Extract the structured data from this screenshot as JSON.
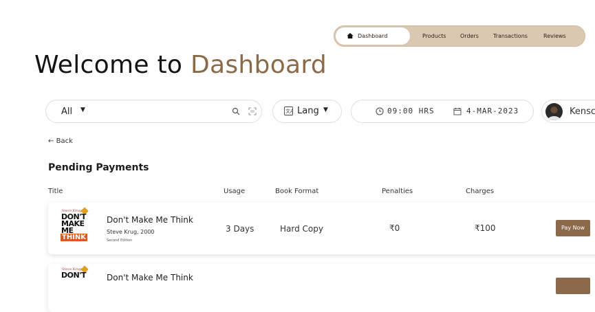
{
  "nav": {
    "items": [
      {
        "label": "Dashboard",
        "active": true
      },
      {
        "label": "Products"
      },
      {
        "label": "Orders"
      },
      {
        "label": "Transactions"
      },
      {
        "label": "Reviews"
      }
    ],
    "colors": {
      "pill": "#dcc8b2",
      "accent": "#8a6a48"
    }
  },
  "header": {
    "title_prefix": "Welcome to ",
    "title_accent": "Dashboard"
  },
  "search": {
    "filter": "All",
    "icons": [
      "search-icon",
      "scan-icon"
    ]
  },
  "lang": {
    "label": "Lang"
  },
  "datetime": {
    "time": "09:00 HRS",
    "date": "4-MAR-2023"
  },
  "user": {
    "name": "Kensc"
  },
  "back": {
    "label": "Back"
  },
  "section": {
    "title": "Pending Payments"
  },
  "table": {
    "headers": [
      "Title",
      "Usage",
      "Book Format",
      "Penalties",
      "Charges"
    ],
    "rows": [
      {
        "cover_author": "Steve Krug",
        "cover_title": "DON'T MAKE ME",
        "cover_accent": "THINK",
        "name": "Don't Make Me Think",
        "author": "Steve Krug, 2000",
        "edition": "Second Edition",
        "usage": "3 Days",
        "format": "Hard Copy",
        "penalty": "₹0",
        "charge": "₹100",
        "action": "Pay Now"
      },
      {
        "cover_author": "Steve Krug",
        "cover_title": "DON'T",
        "name": "Don't Make Me Think"
      }
    ]
  }
}
